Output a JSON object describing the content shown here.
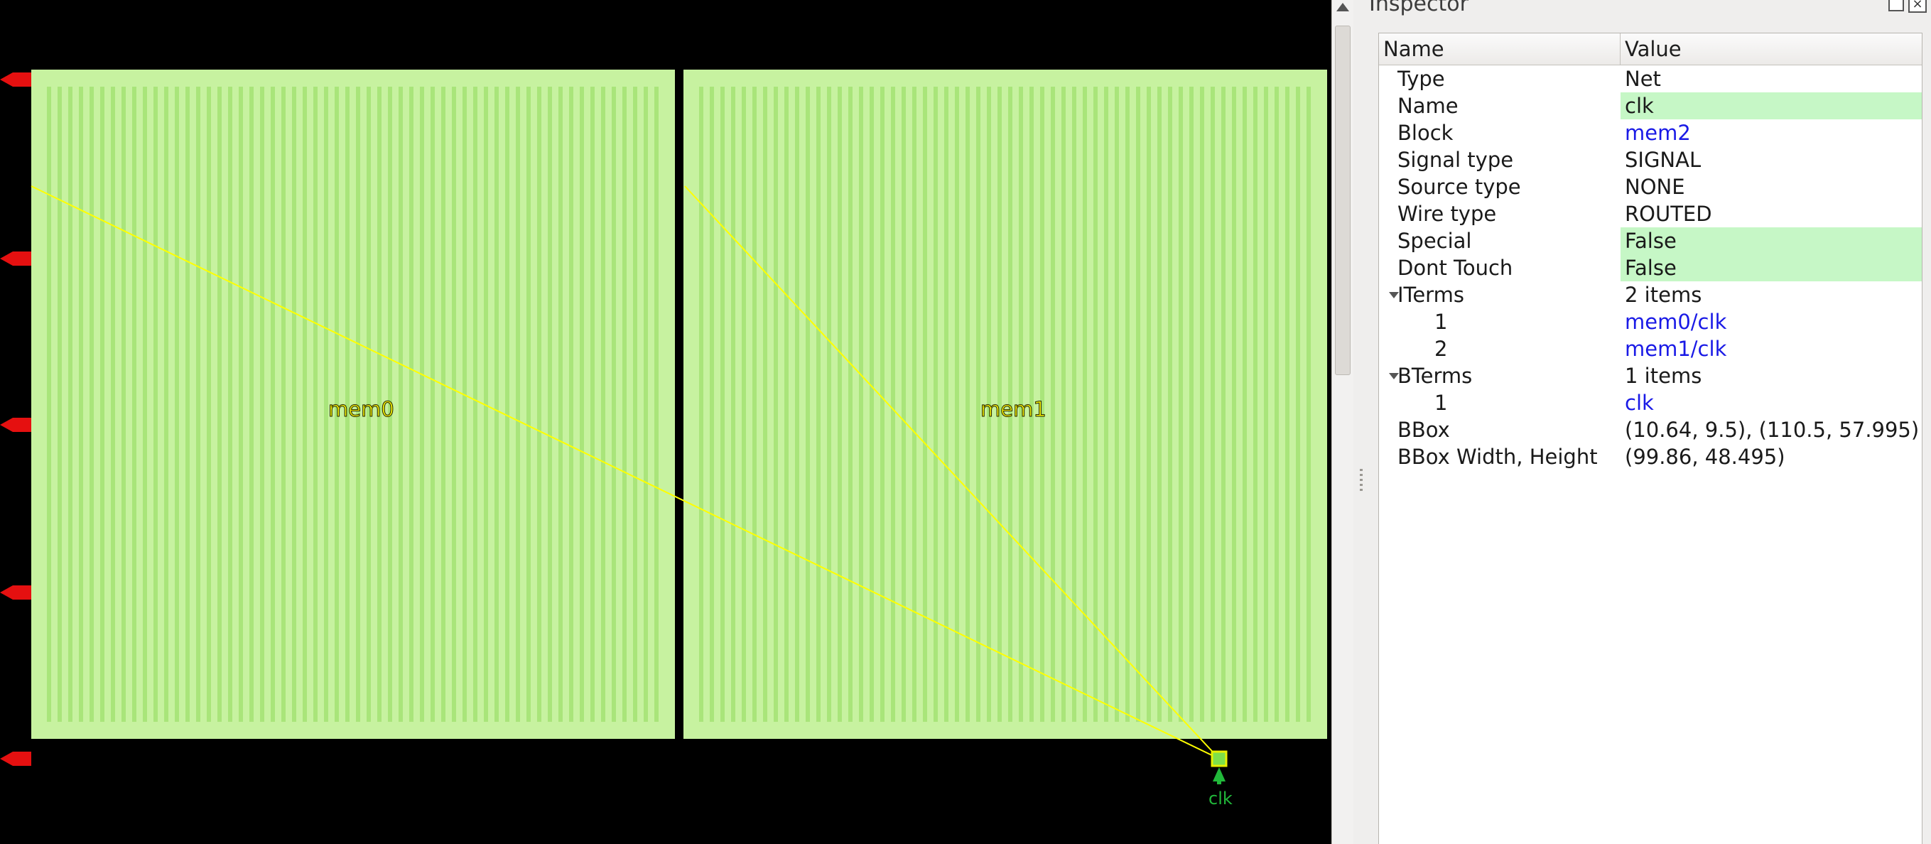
{
  "layout_view": {
    "macros": [
      {
        "label": "mem0"
      },
      {
        "label": "mem1"
      }
    ],
    "bterm_label": "clk",
    "colors": {
      "background": "#000000",
      "macro_fill": "#c7f2a0",
      "macro_stripe": "#a9e57a",
      "flyline": "#ffff00",
      "pin_marker": "#e51010",
      "bterm": "#21b83a"
    }
  },
  "inspector": {
    "title": "Inspector",
    "columns": {
      "name": "Name",
      "value": "Value"
    },
    "rows": [
      {
        "name": "Type",
        "value": "Net",
        "level": 0
      },
      {
        "name": "Name",
        "value": "clk",
        "level": 0,
        "highlight": true
      },
      {
        "name": "Block",
        "value": "mem2",
        "level": 0,
        "link": true
      },
      {
        "name": "Signal type",
        "value": "SIGNAL",
        "level": 0
      },
      {
        "name": "Source type",
        "value": "NONE",
        "level": 0
      },
      {
        "name": "Wire type",
        "value": "ROUTED",
        "level": 0
      },
      {
        "name": "Special",
        "value": "False",
        "level": 0,
        "highlight": true
      },
      {
        "name": "Dont Touch",
        "value": "False",
        "level": 0,
        "highlight": true
      },
      {
        "name": "ITerms",
        "value": "2 items",
        "level": 0,
        "expandable": true
      },
      {
        "name": "1",
        "value": "mem0/clk",
        "level": 1,
        "link": true
      },
      {
        "name": "2",
        "value": "mem1/clk",
        "level": 1,
        "link": true
      },
      {
        "name": "BTerms",
        "value": "1 items",
        "level": 0,
        "expandable": true
      },
      {
        "name": "1",
        "value": "clk",
        "level": 1,
        "link": true
      },
      {
        "name": "BBox",
        "value": "(10.64, 9.5), (110.5, 57.995)",
        "level": 0
      },
      {
        "name": "BBox Width, Height",
        "value": "(99.86, 48.495)",
        "level": 0
      }
    ]
  }
}
